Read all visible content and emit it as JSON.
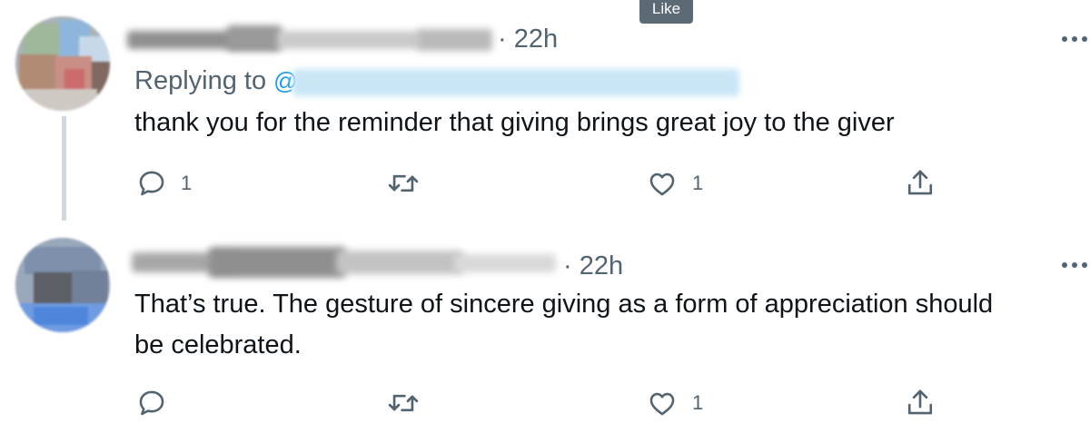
{
  "tooltip": {
    "label": "Like"
  },
  "tweets": [
    {
      "time": "· 22h",
      "reply_prefix": "Replying to",
      "text": "thank you for the reminder that giving brings great joy to the giver",
      "actions": {
        "reply_count": "1",
        "retweet_count": "",
        "like_count": "1"
      }
    },
    {
      "time": "· 22h",
      "text_line1": "That’s true. The gesture of sincere giving as a form of appreciation should",
      "text_line2": "be celebrated.",
      "actions": {
        "reply_count": "",
        "retweet_count": "",
        "like_count": "1"
      }
    }
  ],
  "icons": {
    "reply": "reply-icon",
    "retweet": "retweet-icon",
    "like": "heart-icon",
    "share": "share-icon",
    "more": "more-icon"
  },
  "colors": {
    "text": "#0f1419",
    "secondary": "#536471",
    "thread_line": "#cfd9de",
    "tooltip_bg": "#5b6a75",
    "mention_blur": "#c9e6f7"
  }
}
